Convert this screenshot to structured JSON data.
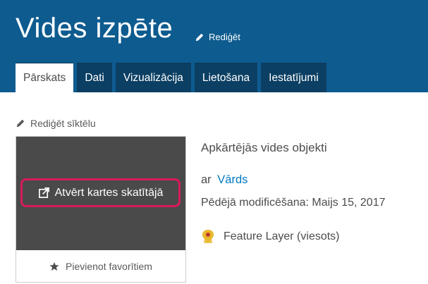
{
  "header": {
    "title": "Vides izpēte",
    "edit_label": "Rediģēt"
  },
  "tabs": [
    {
      "label": "Pārskats",
      "active": true
    },
    {
      "label": "Dati",
      "active": false
    },
    {
      "label": "Vizualizācija",
      "active": false
    },
    {
      "label": "Lietošana",
      "active": false
    },
    {
      "label": "Iestatījumi",
      "active": false
    }
  ],
  "thumbnail": {
    "edit_label": "Rediģēt sīktēlu",
    "open_viewer_label": "Atvērt kartes skatītājā",
    "favorite_label": "Pievienot favorītiem"
  },
  "item": {
    "description": "Apkārtējās vides objekti",
    "owner_prefix": "ar",
    "owner_name": "Vārds",
    "modified": "Pēdējā modificēšana: Maijs 15, 2017",
    "type": "Feature Layer (viesots)"
  },
  "colors": {
    "header_bg": "#0e5b8f",
    "tab_bg": "#0b3f63",
    "highlight": "#d91a5c",
    "link": "#0079c1",
    "thumb_bg": "#4a4a4a",
    "layer_icon": "#e8b92c"
  },
  "icons": {
    "edit": "pencil-icon",
    "open": "external-link-icon",
    "favorite": "star-icon",
    "layer": "feature-layer-icon"
  }
}
